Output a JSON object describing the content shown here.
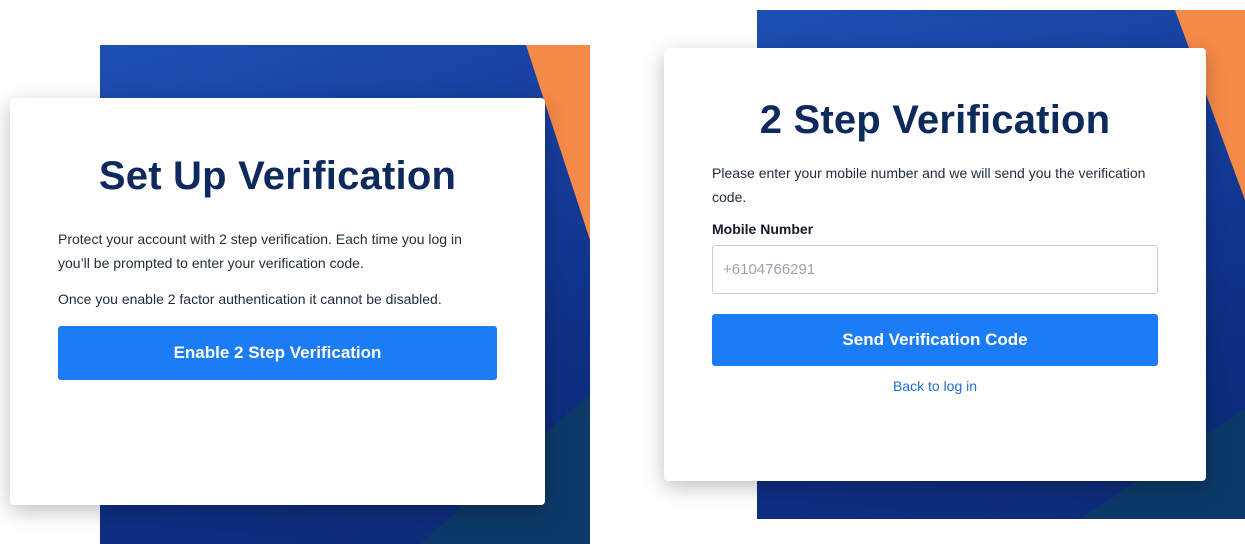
{
  "setup_card": {
    "title": "Set Up Verification",
    "description_1": "Protect your account with 2 step verification. Each time you log in you’ll be prompted to enter your verification code.",
    "description_2": "Once you enable 2 factor authentication it cannot be disabled.",
    "enable_button_label": "Enable 2 Step Verification"
  },
  "verify_card": {
    "title": "2 Step Verification",
    "description": "Please enter your mobile number and we will send you the verification code.",
    "mobile_label": "Mobile Number",
    "mobile_placeholder": "+6104766291",
    "send_button_label": "Send Verification Code",
    "back_link_label": "Back to log in"
  },
  "colors": {
    "primary_button": "#1c7cf4",
    "title_text": "#0e2a5c",
    "backdrop_blue": "#163f9e",
    "accent_orange": "#f68a48",
    "accent_teal": "#0c3a68",
    "link": "#1f6fd6"
  }
}
